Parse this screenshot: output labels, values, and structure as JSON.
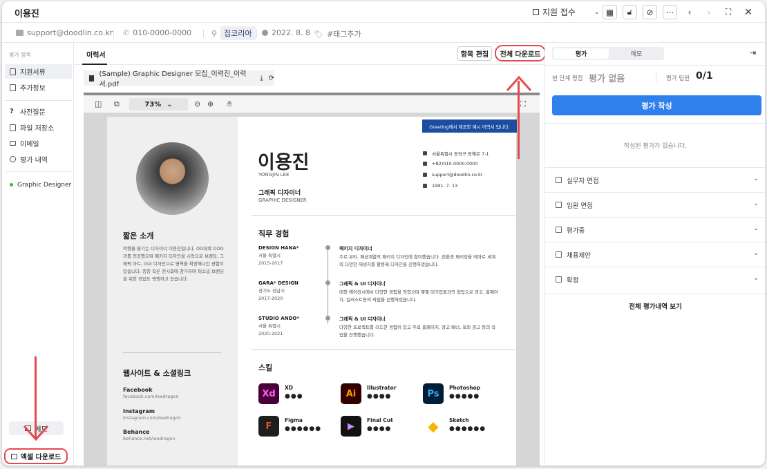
{
  "header": {
    "title": "이용진",
    "status": "지원 접수",
    "icons": [
      "calendar-icon",
      "unlock-icon",
      "block-icon",
      "more-icon",
      "prev-icon",
      "next-icon",
      "expand-icon",
      "close-icon"
    ]
  },
  "info": {
    "email": "support@doodlin.co.kr",
    "phone": "010-0000-0000",
    "location": "집코리아",
    "date": "2022. 8. 8",
    "tag": "#태그추가"
  },
  "sidebar": {
    "section": "평가 항목",
    "items": [
      {
        "label": "지원서류"
      },
      {
        "label": "추가정보"
      },
      {
        "label": "사전질문"
      },
      {
        "label": "파일 저장소"
      },
      {
        "label": "이메일"
      },
      {
        "label": "평가 내역"
      }
    ],
    "job": "Graphic Designer",
    "memo": "메모",
    "excel": "엑셀 다운로드"
  },
  "center": {
    "tab": "이력서",
    "edit": "항목 편집",
    "download_all": "전체 다운로드",
    "file": "(Sample) Graphic Designer 모집_이력진_이력서.pdf",
    "zoom": "73%"
  },
  "resume": {
    "banner": "Greeting에서 제공한 예시 이력서 입니다.",
    "name": "이용진",
    "name_en": "YONGJIN LEE",
    "role": "그래픽 디자이너",
    "role_en": "GRAPHIC DESIGNER",
    "contacts": [
      "서울특별시 동작구 동해로 7-1",
      "+82)010-0000-0000",
      "support@doodlin.co.kr",
      "1991. 7. 13"
    ],
    "intro_title": "짧은 소개",
    "intro": "여행을 즐기는 디자이너 이용진입니다. OO대학 OOO과를 전공했으며 패키지 디자인을 시작으로 브랜딩, 그래픽 아트, GUI 디자인으로 영역을 확장해나간 경험이 있습니다. 종종 작은 전시회에 참가하며 퍼스널 브랜딩을 위한 작업도 병행하고 있습니다.",
    "links_title": "웹사이트 & 소셜링크",
    "links": [
      {
        "name": "Facebook",
        "url": "facebook.com/leedragon"
      },
      {
        "name": "Instagram",
        "url": "instagram.com/leedragon"
      },
      {
        "name": "Behance",
        "url": "behance.net/leedragon"
      }
    ],
    "exp_title": "직무 경험",
    "jobs": [
      {
        "company": "DESIGN HANA*",
        "loc": "서울 특별시",
        "period": "2015-2017",
        "title": "패키지 디자이너",
        "desc": "주로 뷰티, 패션계열의 패키지 디자인에 참여했습니다. 친환경 패키징을 테마로 세계의 다양한 재생지를 활용해 디자인을 진행하였습니다."
      },
      {
        "company": "GARA* DESIGN",
        "loc": "경기도 성남시",
        "period": "2017-2020",
        "title": "그래픽 & UI 디자이너",
        "desc": "대형 에이전시에서 다양한 경험을 하였으며 몇몇 대기업들과의 협업으로 광고, 홈페이지, 일러스트등의 작업을 진행하였습니다."
      },
      {
        "company": "STUDIO ANDO*",
        "loc": "서울 특별시",
        "period": "2020-2021",
        "title": "그래픽 & UI 디자이너",
        "desc": "다양한 프로젝트를 리드한 경험이 있고 주로 홈페이지, 광고 배너, 옥외 광고 등의 작업을 진행했습니다."
      }
    ],
    "skills_title": "스킬",
    "skills": [
      {
        "name": "XD",
        "abbr": "Xd",
        "dots": "●●●",
        "bg": "#470137",
        "fg": "#ff61f6"
      },
      {
        "name": "Illustrator",
        "abbr": "Ai",
        "dots": "●●●●",
        "bg": "#330000",
        "fg": "#ff9a00"
      },
      {
        "name": "Photoshop",
        "abbr": "Ps",
        "dots": "●●●●●",
        "bg": "#001e36",
        "fg": "#31a8ff"
      },
      {
        "name": "Figma",
        "abbr": "F",
        "dots": "●●●●●●",
        "bg": "#1e1e1e",
        "fg": "#f24e1e"
      },
      {
        "name": "Final Cut",
        "abbr": "▶",
        "dots": "●●●●",
        "bg": "#111111",
        "fg": "#c58cff"
      },
      {
        "name": "Sketch",
        "abbr": "◆",
        "dots": "●●●●●●",
        "bg": "#ffffff",
        "fg": "#f7b500"
      }
    ]
  },
  "right": {
    "tab_eval": "평가",
    "tab_memo": "메모",
    "stage_label": "현 단계 평점",
    "stage_value": "평가 없음",
    "team_label": "평가 팀원",
    "team_value": "0/1",
    "write": "평가 작성",
    "empty": "작성된 평가가 없습니다.",
    "stages": [
      "실무자 면접",
      "임원 면접",
      "평가중",
      "채용제안",
      "확정"
    ],
    "all": "전체 평가내역 보기"
  },
  "colors": {
    "accent": "#2f80ed",
    "highlight": "#e5484d"
  }
}
